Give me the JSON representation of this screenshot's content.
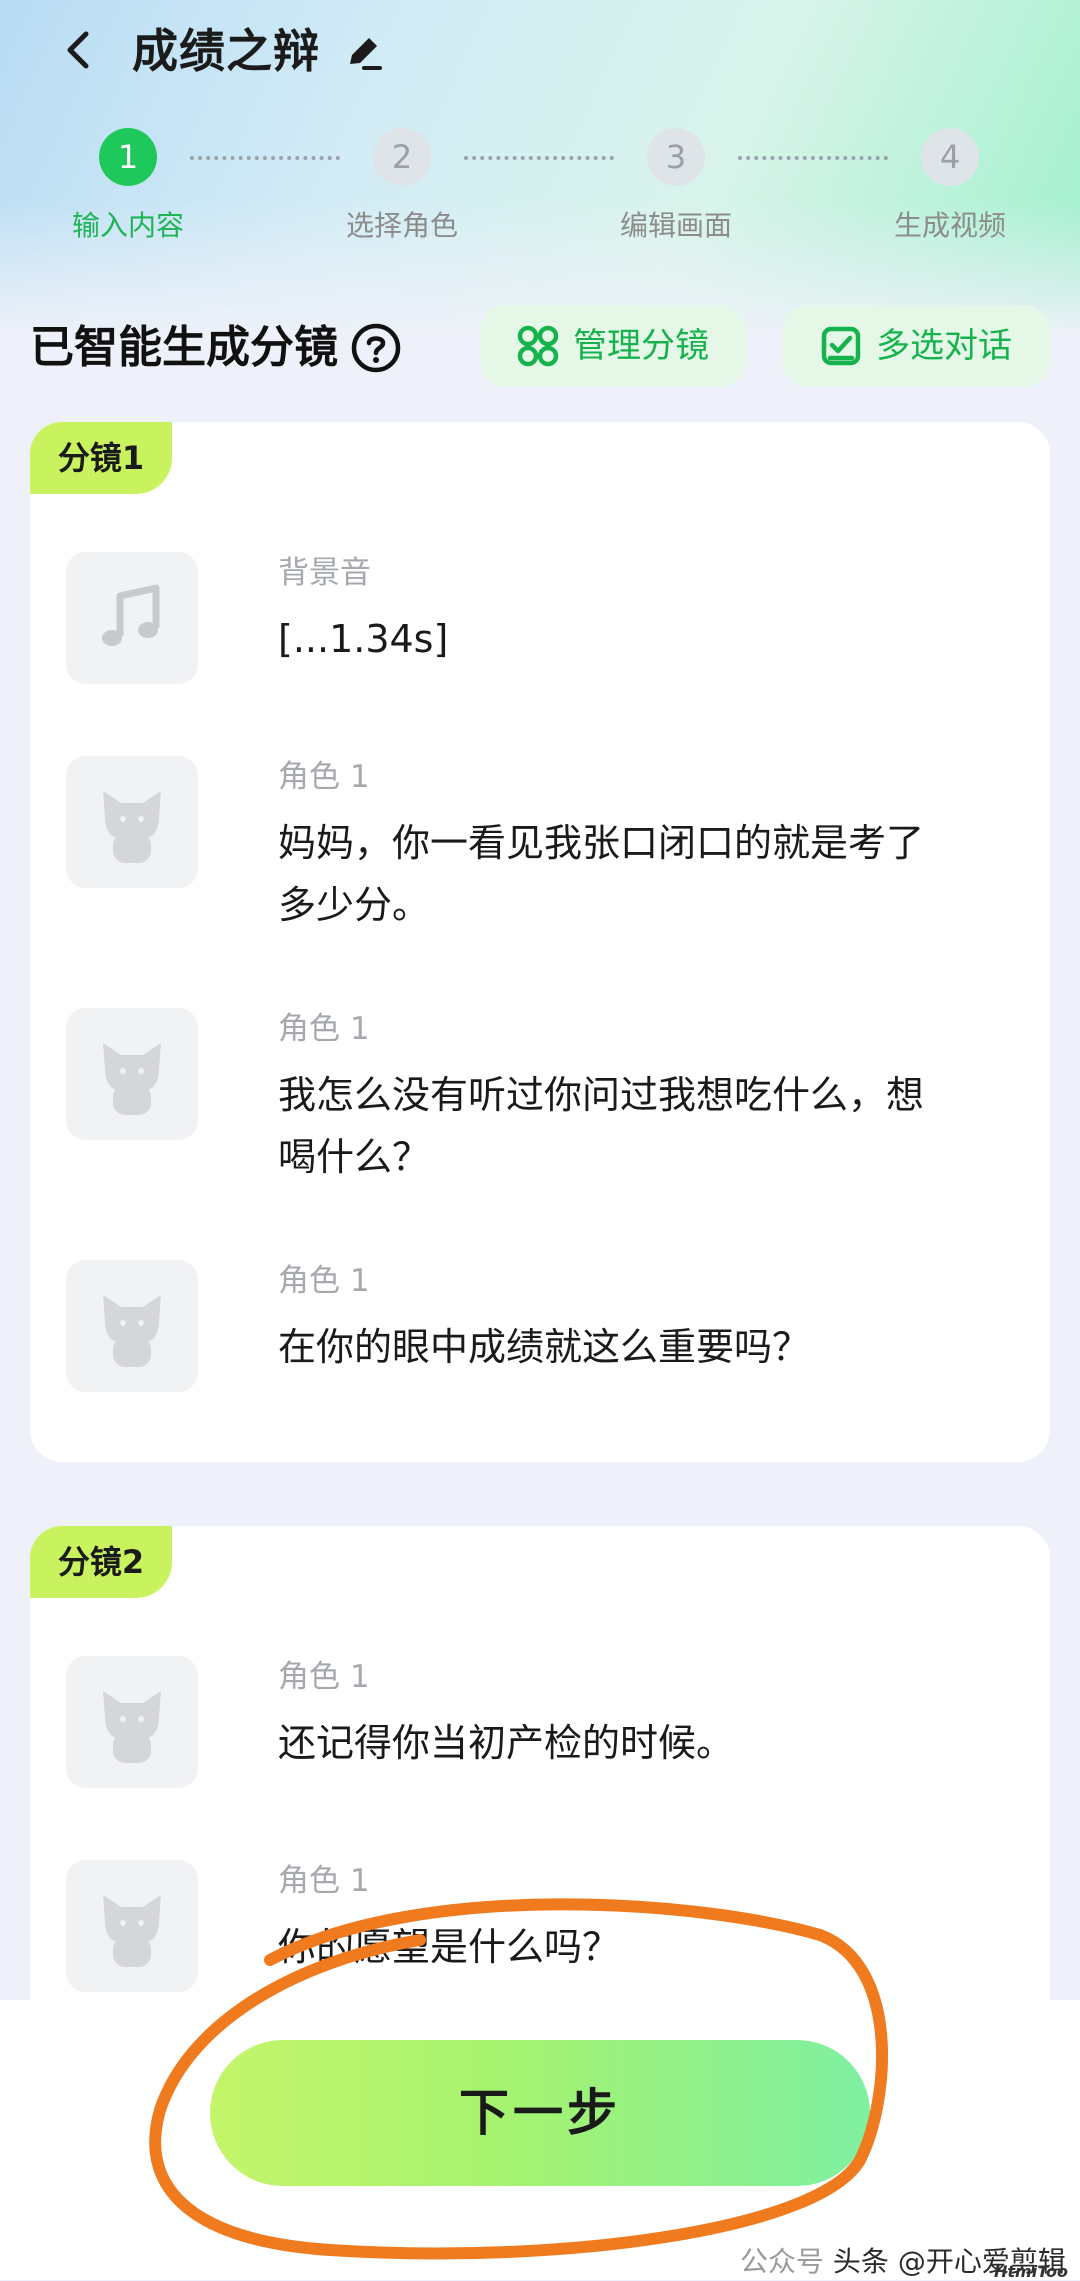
{
  "header": {
    "title": "成绩之辩"
  },
  "steps": [
    {
      "number": "1",
      "label": "输入内容"
    },
    {
      "number": "2",
      "label": "选择角色"
    },
    {
      "number": "3",
      "label": "编辑画面"
    },
    {
      "number": "4",
      "label": "生成视频"
    }
  ],
  "section": {
    "title": "已智能生成分镜",
    "manage_label": "管理分镜",
    "multiselect_label": "多选对话"
  },
  "scenes": [
    {
      "tag": "分镜1",
      "rows": [
        {
          "label": "背景音",
          "text": "[...1.34s]",
          "icon": "music-note-icon"
        },
        {
          "label": "角色 1",
          "text": "妈妈，你一看见我张口闭口的就是考了多少分。",
          "icon": "cat-avatar-icon"
        },
        {
          "label": "角色 1",
          "text": "我怎么没有听过你问过我想吃什么，想喝什么？",
          "icon": "cat-avatar-icon"
        },
        {
          "label": "角色 1",
          "text": "在你的眼中成绩就这么重要吗？",
          "icon": "cat-avatar-icon"
        }
      ]
    },
    {
      "tag": "分镜2",
      "rows": [
        {
          "label": "角色 1",
          "text": "还记得你当初产检的时候。",
          "icon": "cat-avatar-icon"
        },
        {
          "label": "角色 1",
          "text": "你的愿望是什么吗？",
          "icon": "cat-avatar-icon"
        }
      ]
    }
  ],
  "next_button": "下一步",
  "watermark": {
    "prefix": "公众号",
    "main": "头条 @开心爱剪辑",
    "logo": "HtmiToo"
  },
  "colors": {
    "accent": "#1fc85a",
    "tag": "#c9f25f",
    "annotation": "#f07a1e"
  }
}
